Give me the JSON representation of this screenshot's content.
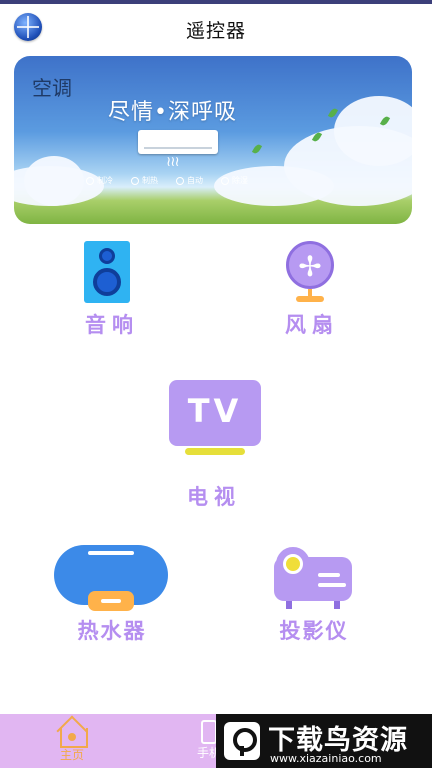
{
  "header": {
    "title": "遥控器",
    "globe_icon": "globe-icon"
  },
  "banner": {
    "label": "空调",
    "slogan": "尽情•深呼吸",
    "modes": [
      "制冷",
      "制热",
      "自动",
      "除湿"
    ]
  },
  "devices": {
    "speaker": {
      "label": "音响",
      "icon": "speaker-icon"
    },
    "fan": {
      "label": "风扇",
      "icon": "fan-icon"
    },
    "tv": {
      "label": "电视",
      "icon_text": "TV"
    },
    "water_heater": {
      "label": "热水器",
      "icon": "water-heater-icon"
    },
    "projector": {
      "label": "投影仪",
      "icon": "projector-icon"
    }
  },
  "bottom_nav": {
    "home": "主页",
    "phone": "手机"
  },
  "watermark": {
    "text": "下载鸟资源",
    "url": "www.xiazainiao.com"
  },
  "colors": {
    "accent_purple": "#b58ef0",
    "nav_bg": "#e1b6f2",
    "nav_active": "#f2a94a"
  }
}
